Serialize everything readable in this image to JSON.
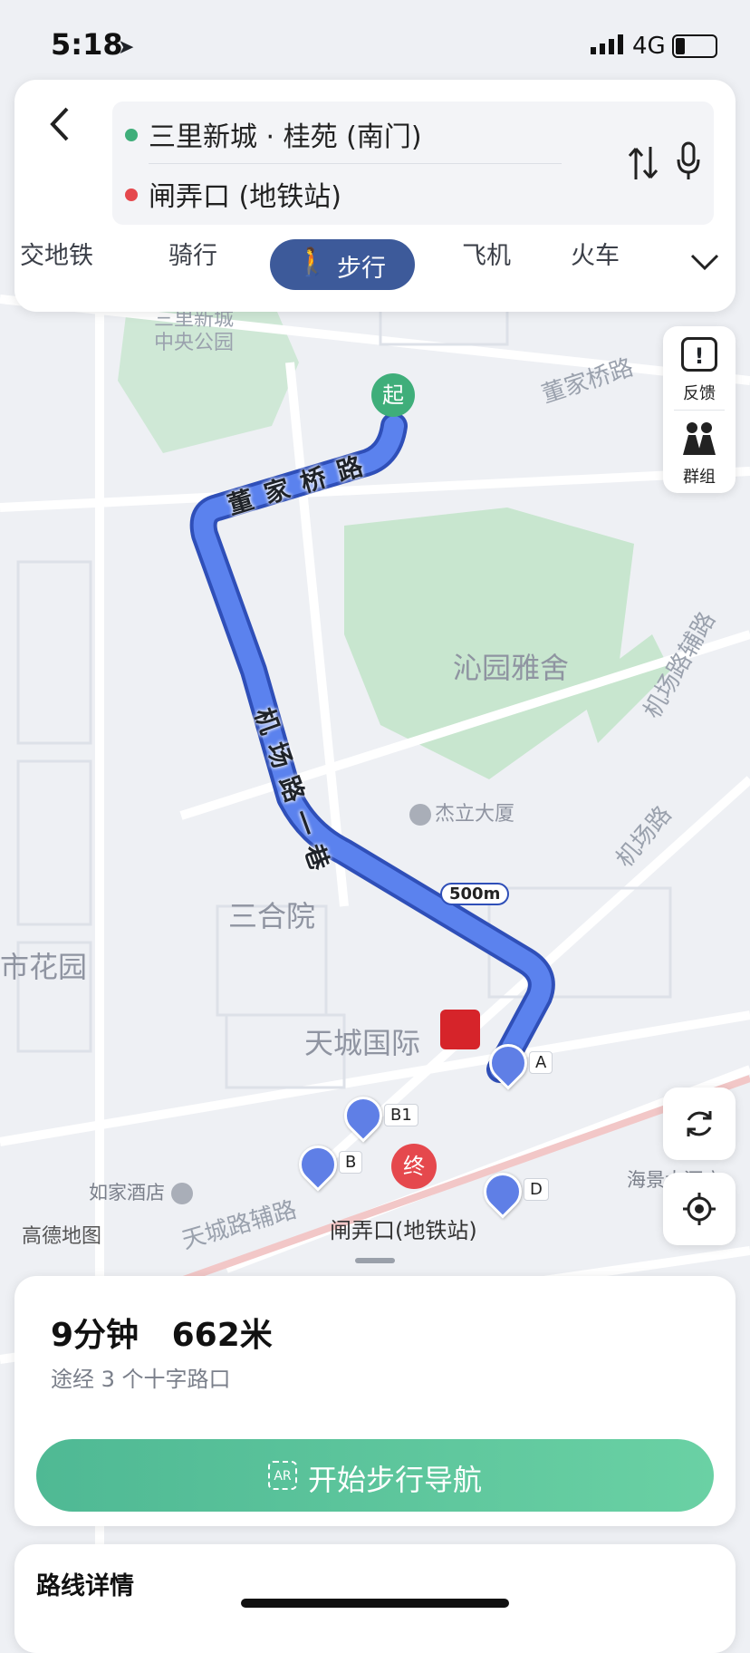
{
  "status_bar": {
    "time": "5:18",
    "network": "4G"
  },
  "route": {
    "origin": "三里新城 · 桂苑 (南门)",
    "destination": "闸弄口 (地铁站)"
  },
  "modes": {
    "transit": "交地铁",
    "cycling": "骑行",
    "walking": "步行",
    "flight": "飞机",
    "train": "火车"
  },
  "side_tools": {
    "feedback": "反馈",
    "group": "群组"
  },
  "map": {
    "park": "三里新城\n中央公园",
    "road_dongjiaqiao": "董家桥路",
    "estate_qinyuan": "沁园雅舍",
    "poi_jieli": "杰立大厦",
    "airport_aux_road": "机场路辅路",
    "airport_road": "机场路",
    "sanheyuan": "三合院",
    "city_garden": "市花园",
    "tiancheng": "天城国际",
    "hotel": "如家酒店",
    "tiancheng_aux_road": "天城路辅路",
    "station": "闸弄口(地铁站)",
    "haijing": "海景大酒店",
    "brand": "高德地图",
    "route_road_1": "董家桥路",
    "route_road_2": "机场路一巷",
    "scale": "500m",
    "start_marker": "起",
    "end_marker": "终",
    "exits": [
      "A",
      "B1",
      "B",
      "D"
    ]
  },
  "summary": {
    "duration": "9分钟",
    "distance": "662米",
    "note": "途经 3 个十字路口",
    "start_button": "开始步行导航",
    "details_title": "路线详情"
  },
  "colors": {
    "route": "#4a6fe3",
    "route_border": "#2f4fb8",
    "green": "#3fae7a",
    "start_button": "#5ec79b",
    "active_mode": "#3d5a9a",
    "end_marker": "#e5484d"
  }
}
